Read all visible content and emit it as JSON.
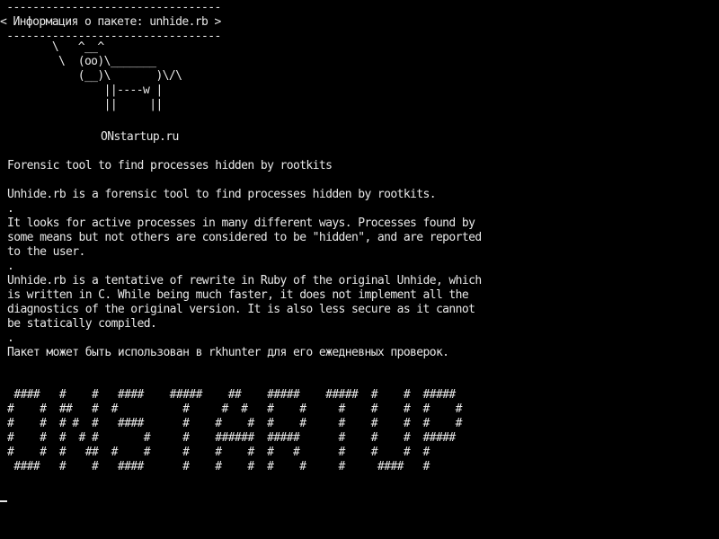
{
  "terminal": {
    "banner_top": " ---------------------------------",
    "banner_title": "< Информация о пакете: unhide.rb >",
    "banner_bottom": " ---------------------------------",
    "cow_art": "        \\   ^__^\n         \\  (oo)\\_______\n            (__)\\       )\\/\\\n                ||----w |\n                ||     ||",
    "site": "ONstartup.ru",
    "short_description": "Forensic tool to find processes hidden by rootkits",
    "long_description": "Unhide.rb is a forensic tool to find processes hidden by rootkits.\n.\nIt looks for active processes in many different ways. Processes found by\nsome means but not others are considered to be \"hidden\", and are reported\nto the user.\n.\nUnhide.rb is a tentative of rewrite in Ruby of the original Unhide, which\nis written in C. While being much faster, it does not implement all the\ndiagnostics of the original version. It is also less secure as it cannot\nbe statically compiled.\n.\nПакет может быть использован в rkhunter для его ежедневных проверок.",
    "figlet_art": " ####   #    #   ####    #####    ##    #####    #####  #    #  #####\n#    #  ##   #  #          #     #  #   #    #     #    #    #  #    #\n#    #  # #  #   ####      #    #    #  #    #     #    #    #  #    #\n#    #  #  # #       #     #    ######  #####      #    #    #  #####\n#    #  #   ##  #    #     #    #    #  #   #      #    #    #  #\n ####   #    #   ####      #    #    #  #    #     #     ####   #"
  }
}
